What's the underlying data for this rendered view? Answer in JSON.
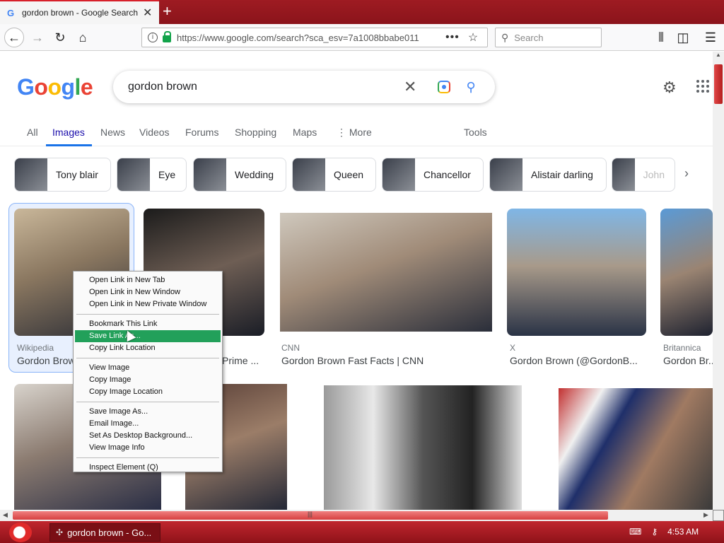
{
  "browser": {
    "tab_title": "gordon brown - Google Search",
    "new_tab": "+",
    "url": "https://www.google.com/search?sca_esv=7a1008bbabe011",
    "search_placeholder": "Search",
    "icons": [
      "back-icon",
      "forward-icon",
      "reload-icon",
      "home-icon",
      "site-info-icon",
      "lock-icon",
      "page-actions-icon",
      "bookmark-star-icon",
      "search-icon",
      "library-icon",
      "sidebar-icon",
      "menu-icon"
    ]
  },
  "google": {
    "logo": [
      "G",
      "o",
      "o",
      "g",
      "l",
      "e"
    ],
    "query": "gordon brown",
    "tabs": [
      "All",
      "Images",
      "News",
      "Videos",
      "Forums",
      "Shopping",
      "Maps",
      "⋮ More"
    ],
    "active_tab": "Images",
    "tools": "Tools",
    "chips": [
      "Tony blair",
      "Eye",
      "Wedding",
      "Queen",
      "Chancellor",
      "Alistair darling",
      "John"
    ],
    "results_row1": [
      {
        "source": "Wikipedia",
        "caption": "Gordon Brown"
      },
      {
        "source": "",
        "caption": "Prime ..."
      },
      {
        "source": "CNN",
        "caption": "Gordon Brown Fast Facts | CNN"
      },
      {
        "source": "X",
        "caption": "Gordon Brown (@GordonB..."
      },
      {
        "source": "Britannica",
        "caption": "Gordon Br..."
      }
    ]
  },
  "context_menu": {
    "items": [
      "Open Link in New Tab",
      "Open Link in New Window",
      "Open Link in New Private Window",
      "---",
      "Bookmark This Link",
      "Save Link As...",
      "Copy Link Location",
      "---",
      "View Image",
      "Copy Image",
      "Copy Image Location",
      "---",
      "Save Image As...",
      "Email Image...",
      "Set As Desktop Background...",
      "View Image Info",
      "---",
      "Inspect Element (Q)"
    ],
    "highlighted": "Save Link As...",
    "highlight_color": "#22a05a"
  },
  "taskbar": {
    "task_title": "gordon brown - Go...",
    "clock": "4:53 AM"
  },
  "colors": {
    "tabbar": "#9e1b22",
    "google_blue": "#1a73e8",
    "link_blue": "#1a0dab"
  }
}
